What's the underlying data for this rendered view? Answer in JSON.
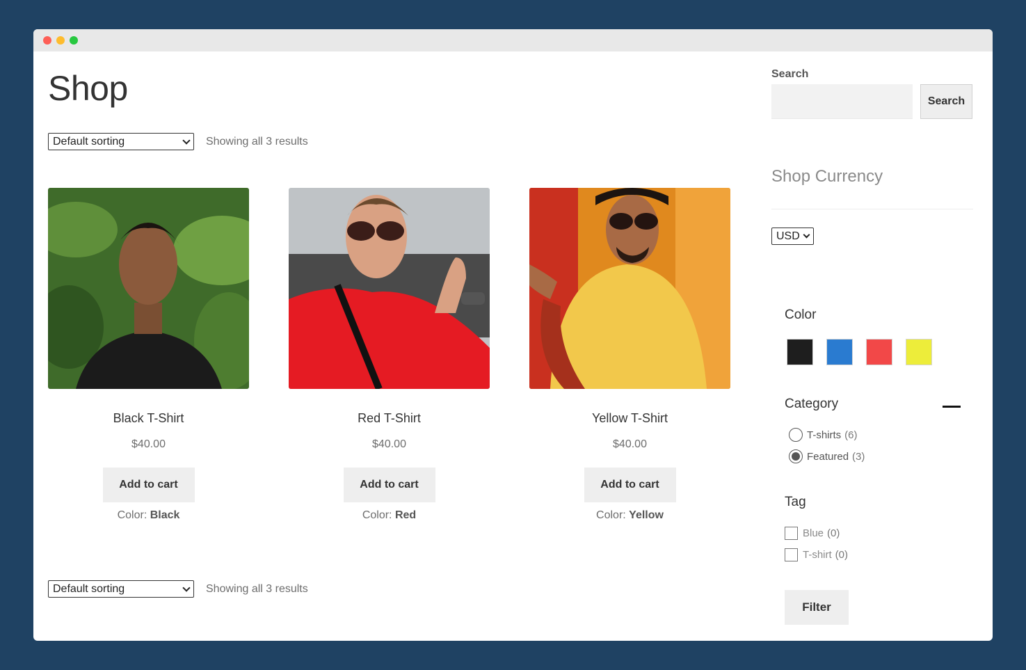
{
  "window": {
    "controls": [
      "close",
      "minimize",
      "maximize"
    ]
  },
  "page": {
    "title": "Shop"
  },
  "toolbar": {
    "sort_value": "Default sorting",
    "result_count": "Showing all 3 results"
  },
  "products": [
    {
      "title": "Black T-Shirt",
      "price": "$40.00",
      "button": "Add to cart",
      "color_label": "Color:",
      "color_value": "Black",
      "shirt_color": "#1b1b1b"
    },
    {
      "title": "Red T-Shirt",
      "price": "$40.00",
      "button": "Add to cart",
      "color_label": "Color:",
      "color_value": "Red",
      "shirt_color": "#e51b23"
    },
    {
      "title": "Yellow T-Shirt",
      "price": "$40.00",
      "button": "Add to cart",
      "color_label": "Color:",
      "color_value": "Yellow",
      "shirt_color": "#f2c84b"
    }
  ],
  "sidebar": {
    "search_label": "Search",
    "search_placeholder": "",
    "search_button": "Search",
    "currency_title": "Shop Currency",
    "currency_value": "USD",
    "color_heading": "Color",
    "swatches": [
      "#1e1e1e",
      "#2a7bd0",
      "#f24848",
      "#eded3a"
    ],
    "category_heading": "Category",
    "categories": [
      {
        "label": "T-shirts",
        "count": "(6)",
        "checked": false
      },
      {
        "label": "Featured",
        "count": "(3)",
        "checked": true
      }
    ],
    "tag_heading": "Tag",
    "tags": [
      {
        "label": "Blue",
        "count": "(0)"
      },
      {
        "label": "T-shirt",
        "count": "(0)"
      }
    ],
    "filter_button": "Filter"
  }
}
